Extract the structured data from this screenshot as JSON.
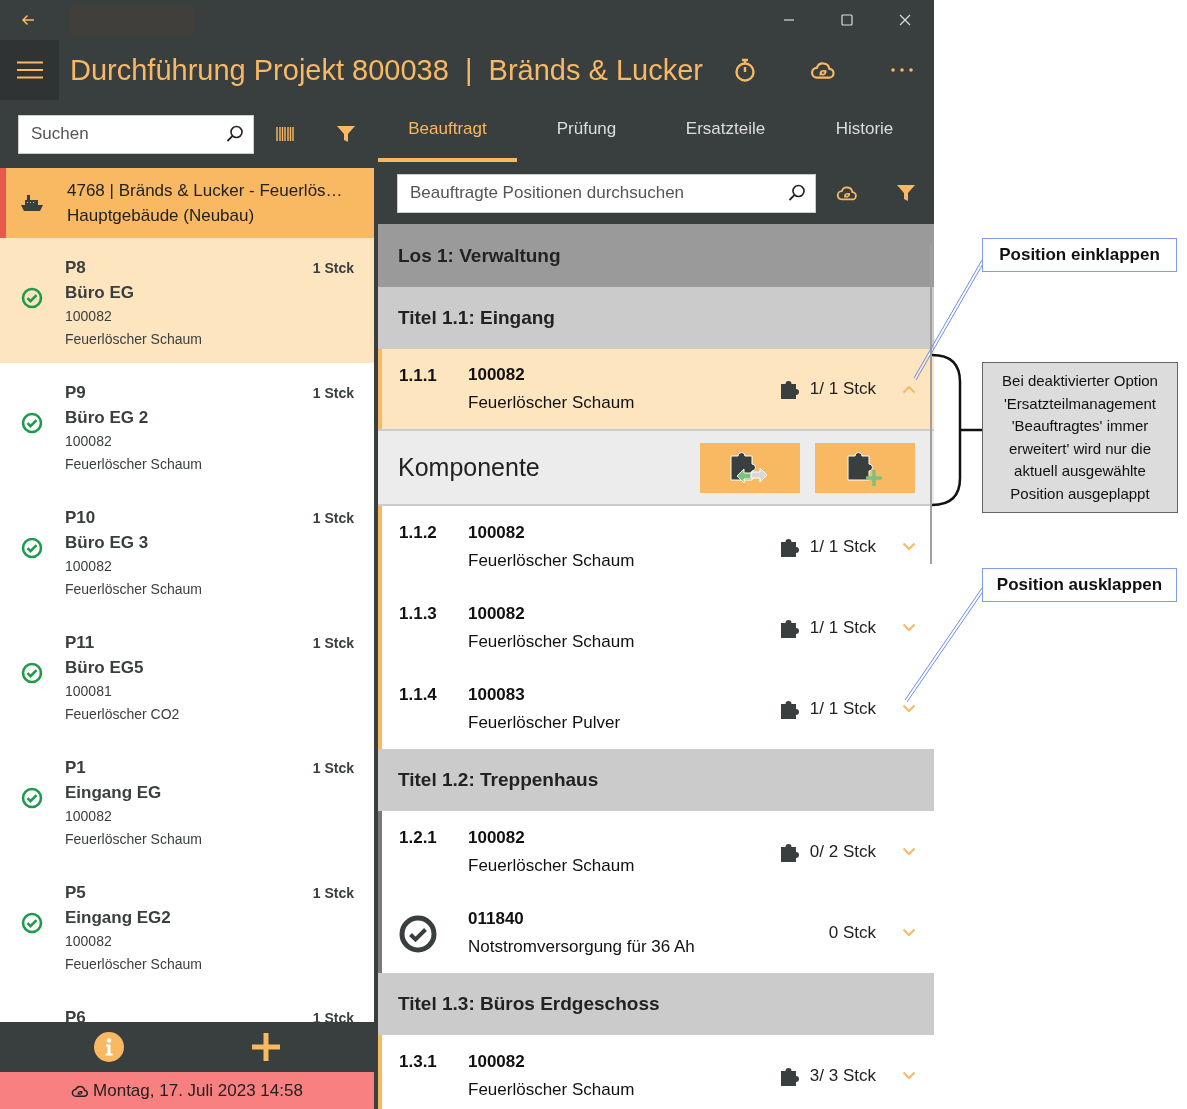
{
  "header": {
    "title": "Durchführung Projekt 800038  |  Bränds & Lucker"
  },
  "sidebar": {
    "search": {
      "placeholder": "Suchen"
    },
    "project": {
      "line_1": "4768  |  Bränds & Lucker - Feuerlös…",
      "line_2": "Hauptgebäude (Neubau)"
    },
    "items": [
      {
        "code": "P8",
        "quantity": "1 Stck",
        "name": "Büro EG",
        "article": "100082",
        "description": "Feuerlöscher Schaum",
        "done": true,
        "selected": true
      },
      {
        "code": "P9",
        "quantity": "1 Stck",
        "name": "Büro EG 2",
        "article": "100082",
        "description": "Feuerlöscher Schaum",
        "done": true,
        "selected": false
      },
      {
        "code": "P10",
        "quantity": "1 Stck",
        "name": "Büro EG 3",
        "article": "100082",
        "description": "Feuerlöscher Schaum",
        "done": true,
        "selected": false
      },
      {
        "code": "P11",
        "quantity": "1 Stck",
        "name": "Büro EG5",
        "article": "100081",
        "description": "Feuerlöscher CO2",
        "done": true,
        "selected": false
      },
      {
        "code": "P1",
        "quantity": "1 Stck",
        "name": "Eingang EG",
        "article": "100082",
        "description": "Feuerlöscher Schaum",
        "done": true,
        "selected": false
      },
      {
        "code": "P5",
        "quantity": "1 Stck",
        "name": "Eingang EG2",
        "article": "100082",
        "description": "Feuerlöscher Schaum",
        "done": true,
        "selected": false
      },
      {
        "code": "P6",
        "quantity": "1 Stck",
        "selected": false
      }
    ],
    "status": "Montag, 17. Juli 2023 14:58"
  },
  "tabs": [
    {
      "label": "Beauftragt",
      "selected": true
    },
    {
      "label": "Prüfung",
      "selected": false
    },
    {
      "label": "Ersatzteile",
      "selected": false
    },
    {
      "label": "Historie",
      "selected": false
    }
  ],
  "search": {
    "placeholder": "Beauftragte Positionen durchsuchen"
  },
  "rows": [
    {
      "kind": "lot",
      "label": "Los 1: Verwaltung"
    },
    {
      "kind": "title",
      "label": "Titel 1.1: Eingang"
    },
    {
      "kind": "position",
      "number": "1.1.1",
      "article": "100082",
      "name": "Feuerlöscher Schaum",
      "parts": true,
      "quantity": "1/ 1 Stck",
      "expanded": true,
      "selected": true,
      "color": "#f9b862"
    },
    {
      "kind": "components",
      "label": "Komponente"
    },
    {
      "kind": "position",
      "number": "1.1.2",
      "article": "100082",
      "name": "Feuerlöscher Schaum",
      "parts": true,
      "quantity": "1/ 1 Stck",
      "expanded": false,
      "selected": false,
      "color": "#f9b862"
    },
    {
      "kind": "position",
      "number": "1.1.3",
      "article": "100082",
      "name": "Feuerlöscher Schaum",
      "parts": true,
      "quantity": "1/ 1 Stck",
      "expanded": false,
      "selected": false,
      "color": "#f9b862"
    },
    {
      "kind": "position",
      "number": "1.1.4",
      "article": "100083",
      "name": "Feuerlöscher Pulver",
      "parts": true,
      "quantity": "1/ 1 Stck",
      "expanded": false,
      "selected": false,
      "color": "#f9b862"
    },
    {
      "kind": "title",
      "label": "Titel 1.2: Treppenhaus"
    },
    {
      "kind": "position",
      "number": "1.2.1",
      "article": "100082",
      "name": "Feuerlöscher Schaum",
      "parts": true,
      "quantity": "0/ 2 Stck",
      "expanded": false,
      "selected": false,
      "color": "#7a7a7a"
    },
    {
      "kind": "component",
      "done": true,
      "article": "011840",
      "name": "Notstromversorgung für 36 Ah",
      "parts": false,
      "quantity": "0 Stck",
      "expanded": false,
      "selected": false,
      "color": "#7a7a7a"
    },
    {
      "kind": "title",
      "label": "Titel 1.3: Büros Erdgeschoss"
    },
    {
      "kind": "position",
      "number": "1.3.1",
      "article": "100082",
      "name": "Feuerlöscher Schaum",
      "parts": true,
      "quantity": "3/ 3 Stck",
      "expanded": false,
      "selected": false,
      "color": "#f9b862"
    }
  ],
  "annotations": {
    "collapse_callout": "Position einklappen",
    "note": "Bei deaktivierter Option 'Ersatzteilmanagement 'Beauftragtes' immer erweitert' wird nur die aktuell ausgewählte Position ausgeplappt",
    "expand_callout": "Position ausklappen"
  }
}
